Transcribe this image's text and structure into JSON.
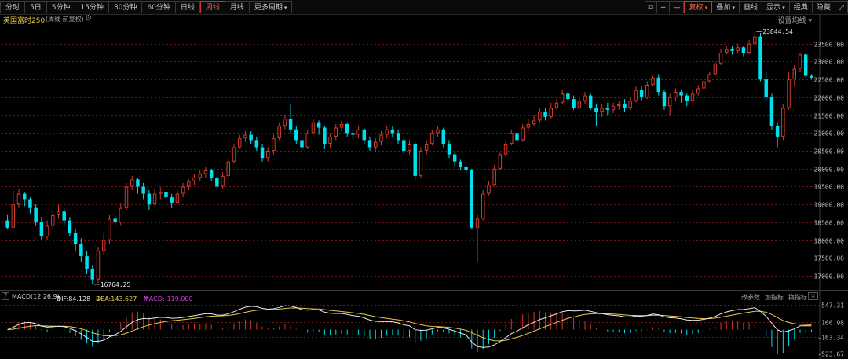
{
  "toolbar": {
    "periods": [
      "分时",
      "5日",
      "5分钟",
      "15分钟",
      "30分钟",
      "60分钟",
      "日线",
      "周线",
      "月线",
      "更多周期"
    ],
    "active_period": "周线",
    "right": {
      "copy_icon": "copy-icon",
      "plus": "+",
      "minus": "—",
      "fuquan": "复权",
      "overlay": "叠加",
      "draw": "画线",
      "display": "显示",
      "classic": "经典",
      "hide": "隐藏",
      "expand_icon": "expand-icon"
    }
  },
  "header": {
    "instrument": "英国富时250",
    "subtitle": "(周线 前复权)",
    "ma_setting": "设置均线"
  },
  "chart_data": {
    "type": "candlestick",
    "y_ticks": [
      23500,
      23000,
      22500,
      22000,
      21500,
      21000,
      20500,
      20000,
      19500,
      19000,
      18500,
      18000,
      17500,
      17000
    ],
    "y_tick_labels": [
      "23500.00",
      "23000.00",
      "22500.00",
      "22000.00",
      "21500.00",
      "21000.00",
      "20500.00",
      "20000.00",
      "19500.00",
      "19000.00",
      "18500.00",
      "18000.00",
      "17500.00",
      "17000.00"
    ],
    "ylim": [
      16650,
      24000
    ],
    "high_annotation": "23844.54",
    "low_annotation": "16764.25",
    "candles": [
      [
        18550,
        18350,
        18700,
        18300
      ],
      [
        18350,
        19000,
        19400,
        18300
      ],
      [
        19000,
        19300,
        19450,
        18900
      ],
      [
        19300,
        19150,
        19350,
        18950
      ],
      [
        19150,
        18900,
        19200,
        18750
      ],
      [
        18900,
        18500,
        19000,
        18400
      ],
      [
        18500,
        18100,
        18650,
        18000
      ],
      [
        18100,
        18400,
        18550,
        18000
      ],
      [
        18400,
        18700,
        18850,
        18300
      ],
      [
        18700,
        18800,
        19000,
        18600
      ],
      [
        18800,
        18550,
        18900,
        18400
      ],
      [
        18550,
        18200,
        18650,
        18100
      ],
      [
        18200,
        17900,
        18300,
        17700
      ],
      [
        17900,
        17550,
        18050,
        17400
      ],
      [
        17550,
        17200,
        17700,
        17050
      ],
      [
        17200,
        16900,
        17300,
        16764
      ],
      [
        16900,
        17700,
        17800,
        16800
      ],
      [
        17700,
        18000,
        18200,
        17600
      ],
      [
        18000,
        18600,
        18700,
        17900
      ],
      [
        18600,
        18500,
        18700,
        18350
      ],
      [
        18500,
        18900,
        19050,
        18400
      ],
      [
        18900,
        19500,
        19600,
        18850
      ],
      [
        19500,
        19700,
        19800,
        19400
      ],
      [
        19700,
        19500,
        19750,
        19300
      ],
      [
        19500,
        19300,
        19600,
        19150
      ],
      [
        19300,
        19000,
        19400,
        18850
      ],
      [
        19000,
        19300,
        19450,
        18950
      ],
      [
        19300,
        19350,
        19500,
        19150
      ],
      [
        19350,
        19200,
        19450,
        19050
      ],
      [
        19200,
        19050,
        19300,
        18900
      ],
      [
        19050,
        19300,
        19400,
        19000
      ],
      [
        19300,
        19500,
        19600,
        19200
      ],
      [
        19500,
        19650,
        19700,
        19400
      ],
      [
        19650,
        19750,
        19850,
        19550
      ],
      [
        19750,
        19850,
        19950,
        19650
      ],
      [
        19850,
        19950,
        20050,
        19750
      ],
      [
        19950,
        19750,
        20000,
        19650
      ],
      [
        19750,
        19500,
        19800,
        19400
      ],
      [
        19500,
        19800,
        19900,
        19450
      ],
      [
        19800,
        20200,
        20300,
        19750
      ],
      [
        20200,
        20600,
        20700,
        20150
      ],
      [
        20600,
        20850,
        20950,
        20550
      ],
      [
        20850,
        20950,
        21050,
        20750
      ],
      [
        20950,
        20800,
        21050,
        20700
      ],
      [
        20800,
        20600,
        20900,
        20500
      ],
      [
        20600,
        20300,
        20700,
        20200
      ],
      [
        20300,
        20500,
        20600,
        20200
      ],
      [
        20500,
        20850,
        20950,
        20400
      ],
      [
        20850,
        21200,
        21300,
        20800
      ],
      [
        21200,
        21400,
        21500,
        21100
      ],
      [
        21400,
        21100,
        21800,
        21000
      ],
      [
        21100,
        20800,
        21200,
        20700
      ],
      [
        20800,
        20600,
        20900,
        20300
      ],
      [
        20600,
        21000,
        21100,
        20550
      ],
      [
        21000,
        21300,
        21400,
        20950
      ],
      [
        21300,
        21150,
        21350,
        20950
      ],
      [
        21150,
        20700,
        21200,
        20550
      ],
      [
        20700,
        20900,
        21000,
        20600
      ],
      [
        20900,
        21150,
        21250,
        20800
      ],
      [
        21150,
        21250,
        21350,
        21050
      ],
      [
        21250,
        21000,
        21300,
        20900
      ],
      [
        21000,
        20950,
        21100,
        20850
      ],
      [
        20950,
        21100,
        21200,
        20850
      ],
      [
        21100,
        20800,
        21150,
        20700
      ],
      [
        20800,
        20600,
        20900,
        20500
      ],
      [
        20600,
        20750,
        20850,
        20450
      ],
      [
        20750,
        20950,
        21050,
        20650
      ],
      [
        20950,
        21100,
        21200,
        20850
      ],
      [
        21100,
        21000,
        21200,
        20900
      ],
      [
        21000,
        20800,
        21100,
        20700
      ],
      [
        20800,
        20500,
        20850,
        20400
      ],
      [
        20500,
        20700,
        20800,
        20400
      ],
      [
        20700,
        19800,
        20750,
        19700
      ],
      [
        19800,
        20500,
        20600,
        19750
      ],
      [
        20500,
        20700,
        20800,
        20400
      ],
      [
        20700,
        21000,
        21100,
        20650
      ],
      [
        21000,
        21100,
        21200,
        20900
      ],
      [
        21100,
        20700,
        21150,
        20600
      ],
      [
        20700,
        20400,
        20800,
        20300
      ],
      [
        20400,
        20200,
        20450,
        20050
      ],
      [
        20200,
        20050,
        20250,
        19950
      ],
      [
        20050,
        19950,
        20100,
        19850
      ],
      [
        19950,
        18350,
        20000,
        18300
      ],
      [
        18350,
        18600,
        18700,
        17400
      ],
      [
        18600,
        19300,
        19400,
        18550
      ],
      [
        19300,
        19550,
        19650,
        19250
      ],
      [
        19550,
        20000,
        20100,
        19500
      ],
      [
        20000,
        20400,
        20450,
        19950
      ],
      [
        20400,
        20700,
        20800,
        20350
      ],
      [
        20700,
        21000,
        21100,
        20650
      ],
      [
        21000,
        20800,
        21100,
        20700
      ],
      [
        20800,
        21150,
        21250,
        20750
      ],
      [
        21150,
        21250,
        21400,
        21050
      ],
      [
        21250,
        21350,
        21500,
        21200
      ],
      [
        21350,
        21600,
        21700,
        21300
      ],
      [
        21600,
        21450,
        21700,
        21350
      ],
      [
        21450,
        21700,
        21850,
        21400
      ],
      [
        21700,
        21850,
        21950,
        21650
      ],
      [
        21850,
        22100,
        22200,
        21800
      ],
      [
        22100,
        21950,
        22150,
        21850
      ],
      [
        21950,
        21700,
        22050,
        21650
      ],
      [
        21700,
        21900,
        22000,
        21650
      ],
      [
        21900,
        22050,
        22150,
        21800
      ],
      [
        22050,
        21700,
        22100,
        21650
      ],
      [
        21700,
        21600,
        21800,
        21200
      ],
      [
        21600,
        21700,
        21800,
        21450
      ],
      [
        21700,
        21650,
        21850,
        21500
      ],
      [
        21650,
        21750,
        21850,
        21550
      ],
      [
        21750,
        21800,
        21900,
        21650
      ],
      [
        21800,
        21700,
        21950,
        21600
      ],
      [
        21700,
        21900,
        22000,
        21650
      ],
      [
        21900,
        22200,
        22300,
        21850
      ],
      [
        22200,
        22000,
        22300,
        21900
      ],
      [
        22000,
        22350,
        22450,
        21950
      ],
      [
        22350,
        22550,
        22600,
        22300
      ],
      [
        22550,
        22150,
        22650,
        22050
      ],
      [
        22150,
        21750,
        22200,
        21650
      ],
      [
        21750,
        22000,
        22100,
        21500
      ],
      [
        22000,
        22150,
        22250,
        21900
      ],
      [
        22150,
        22050,
        22200,
        21850
      ],
      [
        22050,
        21900,
        22100,
        21750
      ],
      [
        21900,
        22100,
        22200,
        21850
      ],
      [
        22100,
        22250,
        22350,
        22050
      ],
      [
        22250,
        22450,
        22550,
        22200
      ],
      [
        22450,
        22650,
        22700,
        22400
      ],
      [
        22650,
        22950,
        23000,
        22600
      ],
      [
        22950,
        23250,
        23350,
        22900
      ],
      [
        23250,
        23350,
        23450,
        23200
      ],
      [
        23350,
        23300,
        23450,
        23200
      ],
      [
        23300,
        23400,
        23500,
        23250
      ],
      [
        23400,
        23250,
        23450,
        23150
      ],
      [
        23250,
        23500,
        23600,
        23200
      ],
      [
        23500,
        23700,
        23844,
        23450
      ],
      [
        23700,
        22500,
        23800,
        22450
      ],
      [
        22500,
        22000,
        22700,
        21900
      ],
      [
        22000,
        21200,
        22100,
        21100
      ],
      [
        21200,
        20900,
        21300,
        20600
      ],
      [
        20900,
        21700,
        21800,
        20800
      ],
      [
        21700,
        22500,
        22700,
        21650
      ],
      [
        22500,
        22800,
        22900,
        22300
      ],
      [
        22800,
        23200,
        23250,
        22700
      ],
      [
        23200,
        22600,
        23250,
        22550
      ],
      [
        22600,
        22550,
        22650,
        22500
      ]
    ]
  },
  "macd": {
    "help": "?",
    "name": "MACD(12,26,9)",
    "dif": "DIF:84.128",
    "dea": "DEA:143.627",
    "macd": "MACD:-119.000",
    "actions": [
      "改参数",
      "加指标",
      "换指标"
    ],
    "close": "×",
    "y_tick_labels": [
      "547.31",
      "166.98",
      "-163.34",
      "-523.67"
    ],
    "y_ticks": [
      547.31,
      166.98,
      -163.34,
      -523.67
    ],
    "ylim": [
      -600,
      620
    ]
  },
  "colors": {
    "up": "#d23a2a",
    "down": "#00e1f0",
    "grid": "#6a1a1a",
    "axis_text": "#c0c0c0",
    "dif": "#e8e8e8",
    "dea": "#e6c84a",
    "macd_label": "#d040d0",
    "active": "#ff6a3d"
  }
}
